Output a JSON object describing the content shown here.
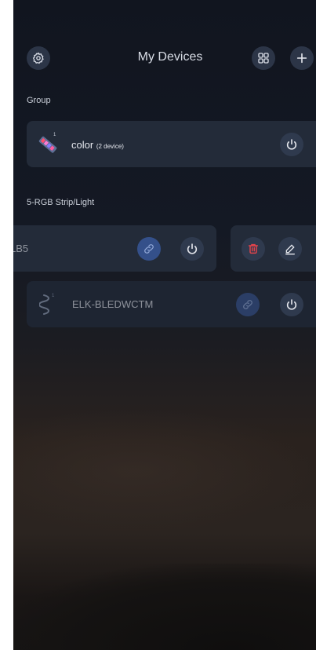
{
  "header": {
    "title": "My Devices",
    "settings_icon": "gear-icon",
    "grid_icon": "grid-icon",
    "add_icon": "plus-icon"
  },
  "group_section": {
    "label": "Group",
    "items": [
      {
        "name": "color",
        "count_label": "(2 device)",
        "icon": "led-strip-icon"
      }
    ]
  },
  "device_section": {
    "label": "5-RGB Strip/Light",
    "items": [
      {
        "name_fragment": "LB5",
        "state": "swiped-open",
        "actions": [
          "link",
          "power",
          "delete",
          "edit"
        ]
      },
      {
        "name": "ELK-BLEDWCTM",
        "state": "offline",
        "actions": [
          "link",
          "power"
        ]
      }
    ]
  },
  "colors": {
    "accent_link": "#34508a",
    "delete_red": "#e0434b",
    "card_bg": "#232b39"
  }
}
